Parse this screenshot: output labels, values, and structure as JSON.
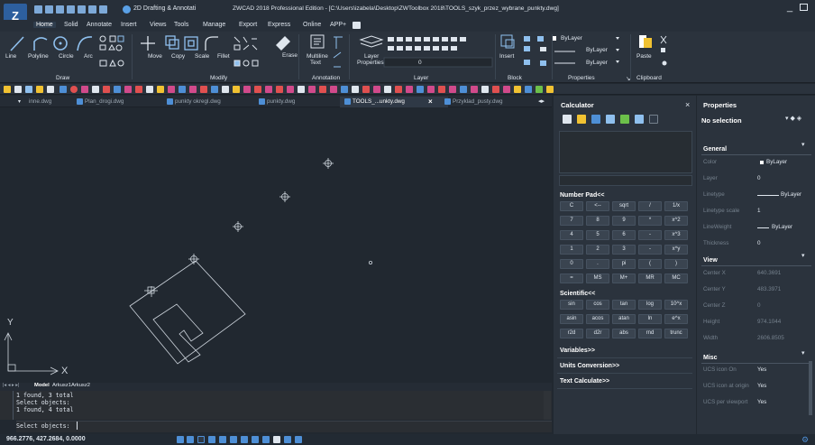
{
  "window": {
    "workspace": "2D Drafting & Annotati",
    "title": "ZWCAD 2018 Professional Edition - [C:\\Users\\izabela\\Desktop\\ZWToolbox 2018\\TOOLS_szyk_przez_wybrane_punkty.dwg]",
    "minimize_glyph": "_"
  },
  "menu": [
    "Home",
    "Solid",
    "Annotate",
    "Insert",
    "Views",
    "Tools",
    "Manage",
    "Export",
    "Express",
    "Online",
    "APP+"
  ],
  "ribbon": {
    "draw": {
      "labels": [
        "Line",
        "Polyline",
        "Circle",
        "Arc"
      ],
      "group": "Draw"
    },
    "modify": {
      "labels": [
        "Move",
        "Copy",
        "Scale",
        "Fillet",
        "Erase"
      ],
      "group": "Modify"
    },
    "annotation": {
      "labels": [
        "Multiline",
        "Text"
      ],
      "group": "Annotation"
    },
    "layer": {
      "labels": [
        "Layer",
        "Properties"
      ],
      "layer_value": "0",
      "group": "Layer"
    },
    "block": {
      "labels": [
        "Insert"
      ],
      "group": "Block"
    },
    "properties": {
      "values": [
        "ByLayer",
        "ByLayer",
        "ByLayer"
      ],
      "group": "Properties"
    },
    "clipboard": {
      "labels": [
        "Paste"
      ],
      "group": "Clipboard"
    }
  },
  "doc_tabs": [
    {
      "label": "inne.dwg",
      "active": false
    },
    {
      "label": "Plan_drogi.dwg",
      "active": false
    },
    {
      "label": "punkty okregl.dwg",
      "active": false
    },
    {
      "label": "punkty.dwg",
      "active": false
    },
    {
      "label": "TOOLS_...unkty.dwg",
      "active": true
    },
    {
      "label": "Przyklad_pusty.dwg",
      "active": false
    }
  ],
  "layout_tabs": [
    "Model",
    "Arkusz1",
    "Arkusz2"
  ],
  "command": {
    "history": [
      "1 found, 3 total",
      "Select objects:",
      "1 found, 4 total"
    ],
    "prompt": "Select objects:"
  },
  "status": {
    "coords": "966.2776, 427.2684, 0.0000"
  },
  "calculator": {
    "title": "Calculator",
    "number_pad_label": "Number Pad<<",
    "number_pad": [
      [
        "C",
        "<--",
        "sqrt",
        "/",
        "1/x"
      ],
      [
        "7",
        "8",
        "9",
        "*",
        "x^2"
      ],
      [
        "4",
        "5",
        "6",
        "-",
        "x^3"
      ],
      [
        "1",
        "2",
        "3",
        "-",
        "x^y"
      ],
      [
        "0",
        ".",
        "pi",
        "(",
        ")"
      ],
      [
        "=",
        "MS",
        "M+",
        "MR",
        "MC"
      ]
    ],
    "scientific_label": "Scientific<<",
    "scientific": [
      [
        "sin",
        "cos",
        "tan",
        "log",
        "10^x"
      ],
      [
        "asin",
        "acos",
        "atan",
        "ln",
        "e^x"
      ],
      [
        "r2d",
        "d2r",
        "abs",
        "rnd",
        "trunc"
      ]
    ],
    "variables_label": "Variables>>",
    "units_label": "Units Conversion>>",
    "text_calc_label": "Text Calculate>>"
  },
  "properties": {
    "title": "Properties",
    "selection": "No selection",
    "general": {
      "label": "General",
      "rows": [
        {
          "k": "Color",
          "v": "ByLayer"
        },
        {
          "k": "Layer",
          "v": "0"
        },
        {
          "k": "Linetype",
          "v": "ByLayer"
        },
        {
          "k": "Linetype scale",
          "v": "1"
        },
        {
          "k": "LineWeight",
          "v": "ByLayer"
        },
        {
          "k": "Thickness",
          "v": "0"
        }
      ]
    },
    "view": {
      "label": "View",
      "rows": [
        {
          "k": "Center X",
          "v": "640.3691"
        },
        {
          "k": "Center Y",
          "v": "483.3971"
        },
        {
          "k": "Center Z",
          "v": "0"
        },
        {
          "k": "Height",
          "v": "974.1044"
        },
        {
          "k": "Width",
          "v": "2606.8505"
        }
      ]
    },
    "misc": {
      "label": "Misc",
      "rows": [
        {
          "k": "UCS icon On",
          "v": "Yes"
        },
        {
          "k": "UCS icon at origin",
          "v": "Yes"
        },
        {
          "k": "UCS per viewport",
          "v": "Yes"
        }
      ]
    }
  },
  "ucs": {
    "x": "X",
    "y": "Y"
  }
}
